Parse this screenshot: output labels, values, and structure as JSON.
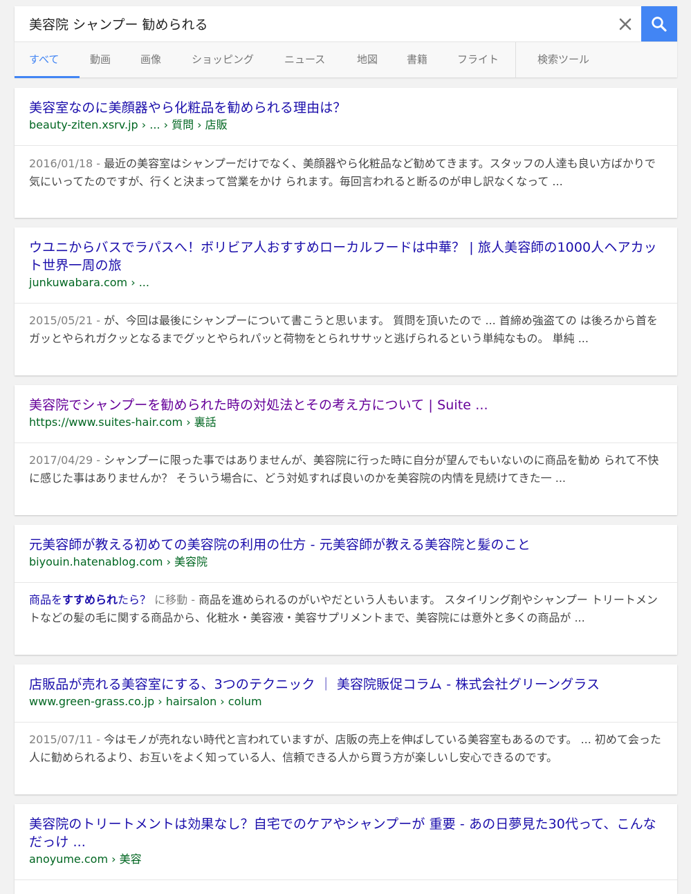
{
  "search": {
    "query": "美容院 シャンプー 勧められる"
  },
  "tabs": [
    {
      "label": "すべて"
    },
    {
      "label": "動画"
    },
    {
      "label": "画像"
    },
    {
      "label": "ショッピング"
    },
    {
      "label": "ニュース"
    },
    {
      "label": "地図"
    },
    {
      "label": "書籍"
    },
    {
      "label": "フライト"
    },
    {
      "label": "検索ツール"
    }
  ],
  "colors": {
    "accent": "#4285f4",
    "link": "#1a0dab",
    "visited": "#660099",
    "url": "#006621"
  },
  "results": [
    {
      "title": "美容室なのに美顔器やら化粧品を勧められる理由は？",
      "url": "beauty-ziten.xsrv.jp › ... › 質問 › 店販",
      "date": "2016/01/18 - ",
      "snippet": "最近の美容室はシャンプーだけでなく、美顔器やら化粧品など勧めてきます。スタッフの人達も良い方ばかりで気にいってたのですが、行くと決まって営業をかけ られます。毎回言われると断るのが申し訳なくなって ..."
    },
    {
      "title": "ウユニからバスでラパスへ！ボリビア人おすすめローカルフードは中華？ | 旅人美容師の1000人ヘアカット世界一周の旅",
      "url": "junkuwabara.com › ...",
      "date": "2015/05/21 - ",
      "snippet": "が、今回は最後にシャンプーについて書こうと思います。 質問を頂いたので ... 首締め強盗ての は後ろから首をガッとやられガクッとなるまでグッとやられパッと荷物をとられササッと逃げられるという単純なもの。 単純 ..."
    },
    {
      "title": "美容院でシャンプーを勧められた時の対処法とその考え方について | Suite ...",
      "url": "https://www.suites-hair.com › 裏話",
      "date": "2017/04/29 - ",
      "snippet": "シャンプーに限った事ではありませんが、美容院に行った時に自分が望んでもいないのに商品を勧め られて不快に感じた事はありませんか？ そういう場合に、どう対処すれば良いのかを美容院の内情を見続けてきた一 ..."
    },
    {
      "title": "元美容師が教える初めての美容院の利用の仕方 - 元美容師が教える美容院と髪のこと",
      "url": "biyouin.hatenablog.com › 美容院",
      "link_prefix": "商品を",
      "link_bold": "すすめられ",
      "link_suffix": "たら？",
      "jump": " に移動 - ",
      "snippet": "商品を進められるのがいやだという人もいます。 スタイリング剤やシャンプー トリートメントなどの髪の毛に関する商品から、化粧水・美容液・美容サプリメントまで、美容院には意外と多くの商品が ..."
    },
    {
      "title": "店販品が売れる美容室にする、3つのテクニック ｜ 美容院販促コラム - 株式会社グリーングラス",
      "url": "www.green-grass.co.jp › hairsalon › colum",
      "date": "2015/07/11 - ",
      "snippet": "今はモノが売れない時代と言われていますが、店販の売上を伸ばしている美容室もあるのです。 ... 初めて会った人に勧められるより、お互いをよく知っている人、信頼できる人から買う方が楽しいし安心できるのです。"
    },
    {
      "title": "美容院のトリートメントは効果なし？自宅でのケアやシャンプーが 重要 - あの日夢見た30代って、こんなだっけ ...",
      "url": "anoyume.com › 美容"
    }
  ]
}
